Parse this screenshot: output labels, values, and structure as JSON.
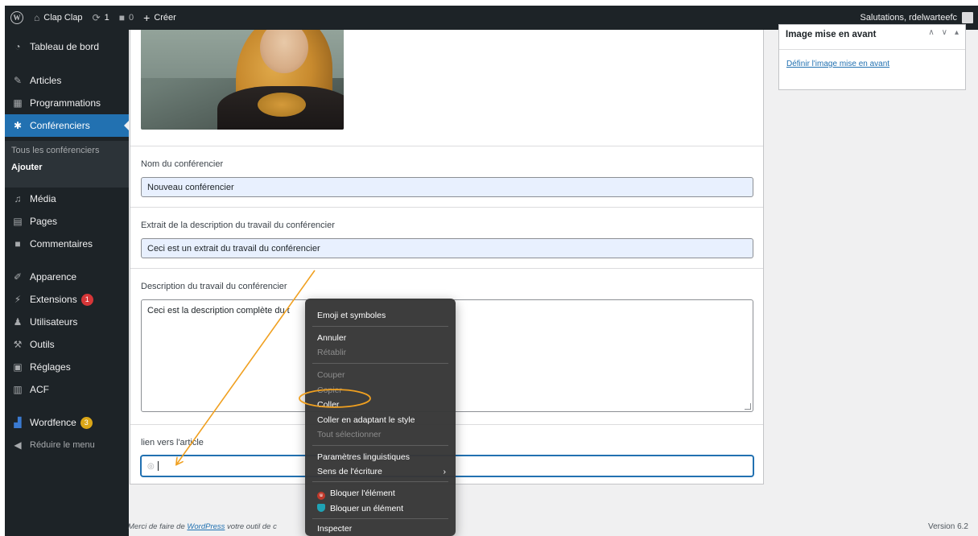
{
  "adminbar": {
    "site_name": "Clap Clap",
    "updates_count": "1",
    "comments_count": "0",
    "new_label": "Créer",
    "greeting": "Salutations, rdelwarteefc"
  },
  "sidebar": {
    "items": [
      {
        "label": "Tableau de bord",
        "icon": "dashboard-icon"
      },
      {
        "label": "Articles",
        "icon": "pin-icon"
      },
      {
        "label": "Programmations",
        "icon": "calendar-icon"
      },
      {
        "label": "Conférenciers",
        "icon": "person-icon"
      },
      {
        "label": "Média",
        "icon": "media-icon"
      },
      {
        "label": "Pages",
        "icon": "pages-icon"
      },
      {
        "label": "Commentaires",
        "icon": "comment-icon"
      },
      {
        "label": "Apparence",
        "icon": "brush-icon"
      },
      {
        "label": "Extensions",
        "icon": "plugin-icon",
        "badge": "1"
      },
      {
        "label": "Utilisateurs",
        "icon": "users-icon"
      },
      {
        "label": "Outils",
        "icon": "wrench-icon"
      },
      {
        "label": "Réglages",
        "icon": "settings-icon"
      },
      {
        "label": "ACF",
        "icon": "acf-icon"
      },
      {
        "label": "Wordfence",
        "icon": "wordfence-icon",
        "badge": "3"
      },
      {
        "label": "Réduire le menu",
        "icon": "collapse-icon"
      }
    ],
    "submenu": {
      "all": "Tous les conférenciers",
      "add": "Ajouter"
    }
  },
  "form": {
    "name_label": "Nom du conférencier",
    "name_value": "Nouveau conférencier",
    "excerpt_label": "Extrait de la description du travail du conférencier",
    "excerpt_value": "Ceci est un extrait du travail du conférencier",
    "description_label": "Description du travail du conférencier",
    "description_value": "Ceci est la description complète du t",
    "link_label": "lien vers l'article",
    "link_value": ""
  },
  "metabox": {
    "title": "Image mise en avant",
    "link": "Définir l'image mise en avant"
  },
  "context_menu": {
    "items": [
      {
        "label": "Emoji et symboles",
        "enabled": true
      },
      {
        "label": "Annuler",
        "enabled": true
      },
      {
        "label": "Rétablir",
        "enabled": false
      },
      {
        "label": "Couper",
        "enabled": false
      },
      {
        "label": "Copier",
        "enabled": false
      },
      {
        "label": "Coller",
        "enabled": true,
        "highlighted": true
      },
      {
        "label": "Coller en adaptant le style",
        "enabled": true
      },
      {
        "label": "Tout sélectionner",
        "enabled": false
      },
      {
        "label": "Paramètres linguistiques",
        "enabled": true
      },
      {
        "label": "Sens de l'écriture",
        "enabled": true,
        "submenu": true
      },
      {
        "label": "Bloquer l'élément",
        "enabled": true,
        "icon": "ublock-icon"
      },
      {
        "label": "Bloquer un élément",
        "enabled": true,
        "icon": "shield-icon"
      },
      {
        "label": "Inspecter",
        "enabled": true
      }
    ]
  },
  "footer": {
    "text_before": "Merci de faire de ",
    "link": "WordPress",
    "text_after": " votre outil de c",
    "version": "Version 6.2"
  },
  "colors": {
    "adminbar": "#1d2327",
    "accent": "#2271b1",
    "annotation": "#f0a020",
    "badge_red": "#d63638",
    "badge_yellow": "#dba617"
  }
}
